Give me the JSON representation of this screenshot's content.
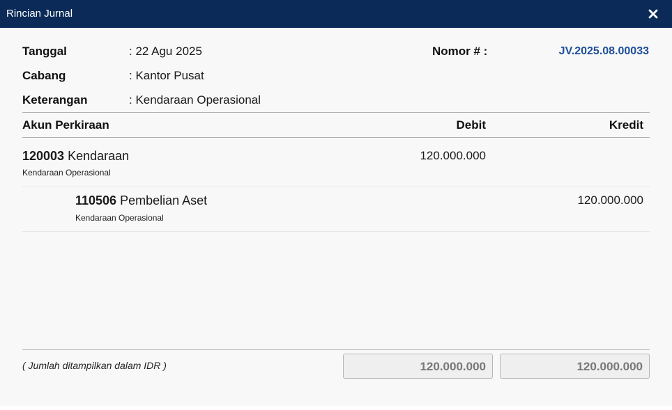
{
  "dialog": {
    "title": "Rincian Jurnal",
    "close_icon": "close-icon"
  },
  "header": {
    "date_label": "Tanggal",
    "date_value": ": 22 Agu 2025",
    "branch_label": "Cabang",
    "branch_value": ": Kantor Pusat",
    "note_label": "Keterangan",
    "note_value": ": Kendaraan Operasional",
    "number_label": "Nomor # :",
    "number_value": "JV.2025.08.00033"
  },
  "table": {
    "columns": [
      "Akun Perkiraan",
      "Debit",
      "Kredit"
    ],
    "rows": [
      {
        "code": "120003",
        "name": "Kendaraan",
        "description": "Kendaraan Operasional",
        "debit": "120.000.000",
        "credit": ""
      },
      {
        "code": "110506",
        "name": "Pembelian Aset",
        "description": "Kendaraan Operasional",
        "debit": "",
        "credit": "120.000.000"
      }
    ]
  },
  "footer": {
    "currency_note": "( Jumlah ditampilkan dalam IDR )",
    "total_debit": "120.000.000",
    "total_credit": "120.000.000"
  },
  "colors": {
    "titlebar": "#0b2a57",
    "link": "#1e4f98"
  }
}
